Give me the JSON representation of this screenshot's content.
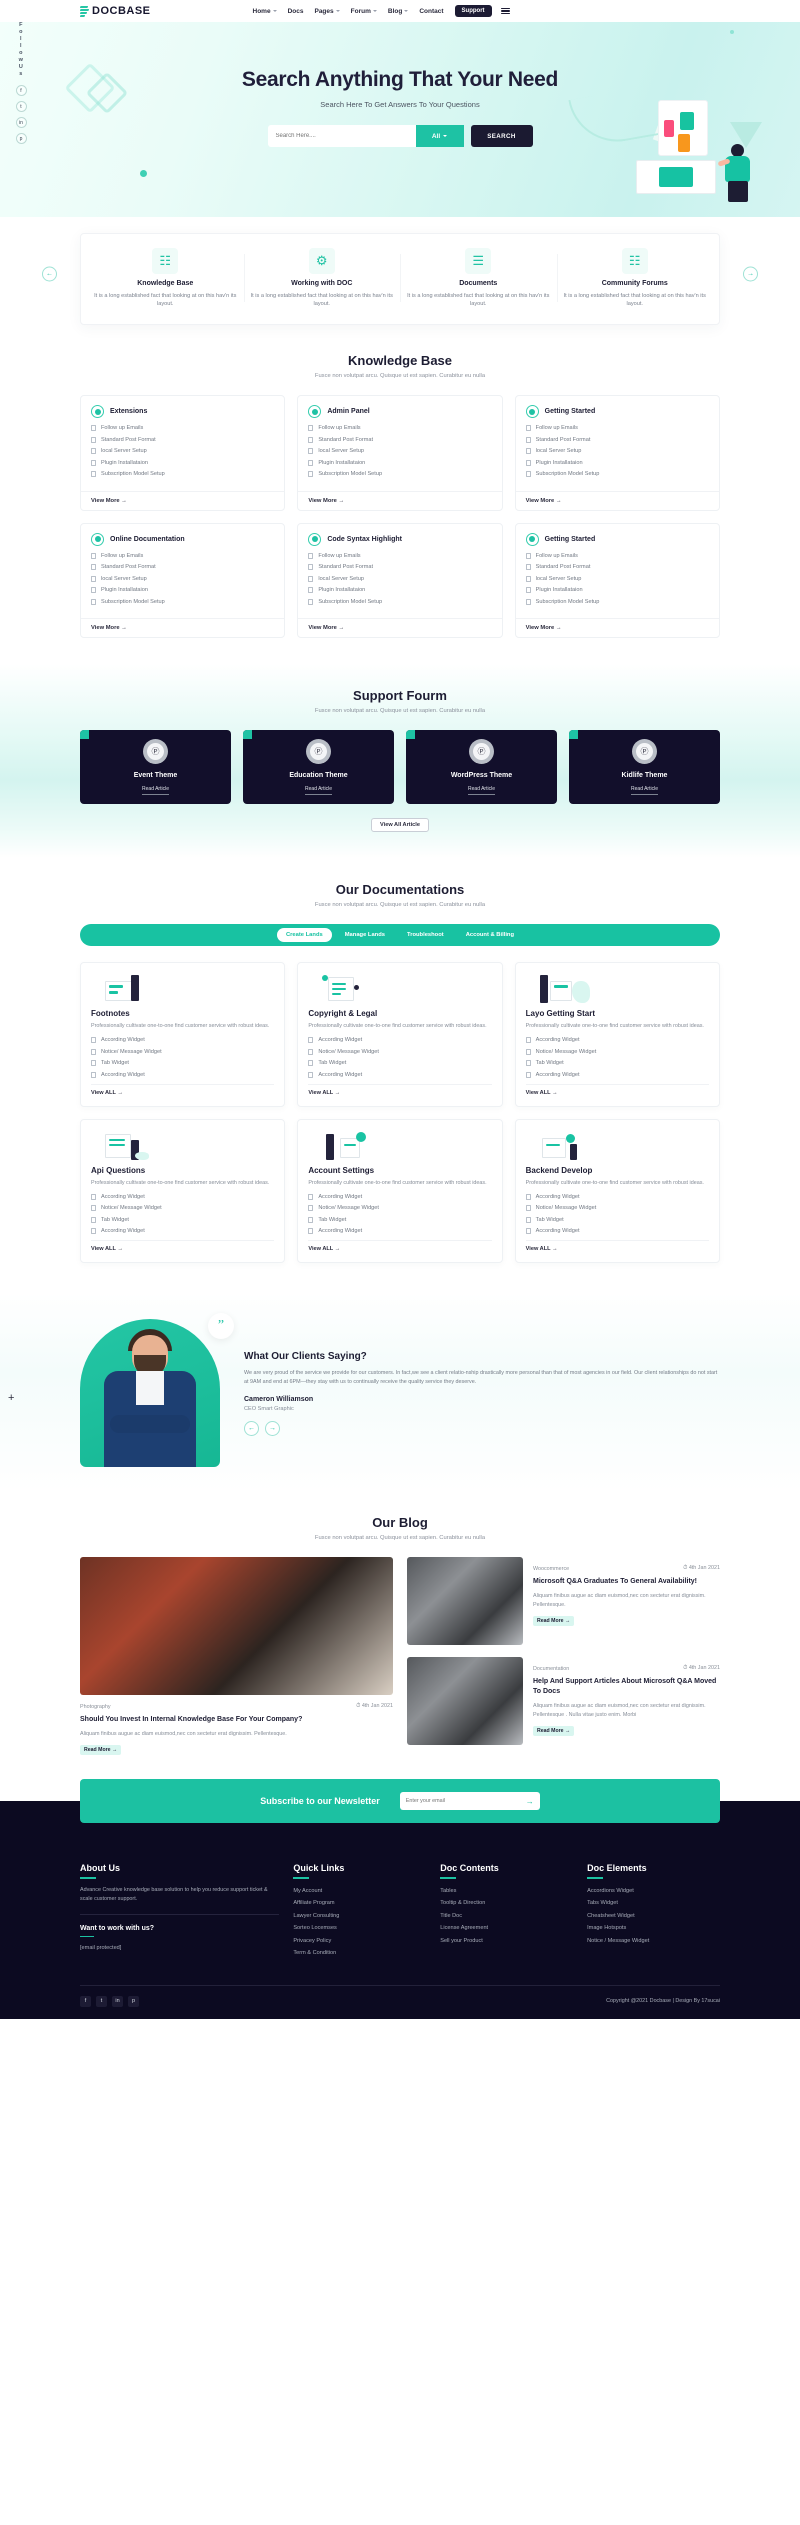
{
  "header": {
    "logo": "DOCBASE",
    "nav": [
      {
        "label": "Home",
        "caret": true
      },
      {
        "label": "Docs",
        "caret": false
      },
      {
        "label": "Pages",
        "caret": true
      },
      {
        "label": "Forum",
        "caret": true
      },
      {
        "label": "Blog",
        "caret": true
      },
      {
        "label": "Contact",
        "caret": false
      }
    ],
    "support_label": "Support",
    "menu_icon": "hamburger-icon"
  },
  "rail": {
    "text": "Follow Us",
    "icons": [
      "f",
      "t",
      "in",
      "p"
    ]
  },
  "hero": {
    "title": "Search Anything That Your Need",
    "subtitle": "Search Here To Get Answers To Your Questions",
    "search_placeholder": "Search Here....",
    "category": "All",
    "button": "SEARCH"
  },
  "features": {
    "prev_icon": "arrow-left-icon",
    "next_icon": "arrow-right-icon",
    "items": [
      {
        "icon": "book-icon",
        "glyph": "☷",
        "title": "Knowledge Base",
        "desc": "It is a long established fact that looking at on this hav'n its layout."
      },
      {
        "icon": "gear-doc-icon",
        "glyph": "⚙",
        "title": "Working with DOC",
        "desc": "It is a long established fact that looking at on this hav'n its layout."
      },
      {
        "icon": "document-check-icon",
        "glyph": "☰",
        "title": "Documents",
        "desc": "It is a long established fact that looking at on this hav'n its layout."
      },
      {
        "icon": "forum-icon",
        "glyph": "☷",
        "title": "Community Forums",
        "desc": "It is a long established fact that looking at on this hav'n its layout."
      }
    ]
  },
  "knowledge_base": {
    "title": "Knowledge Base",
    "subtitle": "Fusce non volutpat arcu. Quisque ut est sapien. Curabitur eu nulla",
    "view_more": "View More  →",
    "items": [
      "Follow up Emails",
      "Standard Post Format",
      "local Server Setup",
      "Plugin Installataion",
      "Subscription Model Setup"
    ],
    "cards": [
      {
        "title": "Extensions"
      },
      {
        "title": "Admin Panel"
      },
      {
        "title": "Getting Started"
      },
      {
        "title": "Online Documentation"
      },
      {
        "title": "Code Syntax Highlight"
      },
      {
        "title": "Getting Started"
      }
    ]
  },
  "forum": {
    "title": "Support Fourm",
    "subtitle": "Fusce non volutpat arcu. Quisque ut est sapien. Curabitur eu nulla",
    "read_article": "Read Article",
    "view_all": "View All Article",
    "cards": [
      {
        "title": "Event Theme",
        "avatar": "wordpress-icon"
      },
      {
        "title": "Education Theme",
        "avatar": "wordpress-icon"
      },
      {
        "title": "WordPress Theme",
        "avatar": "wordpress-icon"
      },
      {
        "title": "Kidlife Theme",
        "avatar": "wordpress-icon"
      }
    ]
  },
  "documentations": {
    "title": "Our Documentations",
    "subtitle": "Fusce non volutpat arcu. Quisque ut est sapien. Curabitur eu nulla",
    "tabs": [
      {
        "label": "Create Lands",
        "active": true
      },
      {
        "label": "Manage Lands",
        "active": false
      },
      {
        "label": "Troubleshoot",
        "active": false
      },
      {
        "label": "Account & Billing",
        "active": false
      }
    ],
    "view_all": "View ALL →",
    "desc": "Professionally cultivate one-to-one find customer service with robust ideas.",
    "widgets": [
      "According Widget",
      "Notice/ Message Widget",
      "Tab Widget",
      "According Widget"
    ],
    "cards": [
      {
        "title": "Footnotes"
      },
      {
        "title": "Copyright & Legal"
      },
      {
        "title": "Layo Getting Start"
      },
      {
        "title": "Api Questions"
      },
      {
        "title": "Account Settings"
      },
      {
        "title": "Backend Develop"
      }
    ]
  },
  "testimonial": {
    "heading": "What Our Clients Saying?",
    "body": "We are very proud of the service we provide for our customers. In fact,we see a client relatio-nship drastically more personal than that of most agencies in our field. Our client relationships do not start at 9AM and end at 6PM—they stay with us to continually receive the quality service they deserve.",
    "name": "Cameron Williamson",
    "role": "CEO Smart Graphic",
    "quote_glyph": "”",
    "prev_icon": "arrow-left-icon",
    "next_icon": "arrow-right-icon"
  },
  "blog": {
    "title": "Our Blog",
    "subtitle": "Fusce non volutpat arcu. Quisque ut est sapien. Curabitur eu nulla",
    "read_more": "Read More →",
    "featured": {
      "category": "Photography",
      "date": "4th Jan 2021",
      "title": "Should You Invest In Internal Knowledge Base For Your Company?",
      "excerpt": "Aliquam finibus augue ac diam euismod,nec con sectetur erat dignissim. Pellentesque."
    },
    "posts": [
      {
        "category": "Woocommerce",
        "date": "4th Jan 2021",
        "title": "Microsoft Q&A Graduates To General Availability!",
        "excerpt": "Aliquam finibus augue ac diam euismod,nec con sectetur erat dignissim. Pellentesque."
      },
      {
        "category": "Documentation",
        "date": "4th Jan 2021",
        "title": "Help And Support Articles About Microsoft Q&A Moved To Docs",
        "excerpt": "Aliquam finibus augue ac diam euismod,nec con sectetur erat dignissim. Pellentesque . Nulla vitae justo enim. Morbi"
      }
    ]
  },
  "newsletter": {
    "title": "Subscribe to our Newsletter",
    "placeholder": "Enter your email",
    "submit_icon": "arrow-right-icon"
  },
  "footer": {
    "about": {
      "heading": "About Us",
      "text": "Advance Creative knowledge base solution to help you reduce support ticket & scale customer support.",
      "work_heading": "Want to work with us?",
      "email": "[email protected]"
    },
    "columns": [
      {
        "heading": "Quick Links",
        "links": [
          "My Account",
          "Affiliate Program",
          "Lawyer Consulting",
          "Sorteo Locemses",
          "Privacey Policy",
          "Term & Condition"
        ]
      },
      {
        "heading": "Doc Contents",
        "links": [
          "Tables",
          "Tooltip & Direction",
          "Title Doc",
          "License Agreement",
          "Sell your Product"
        ]
      },
      {
        "heading": "Doc Elements",
        "links": [
          "Accordions Widget",
          "Tabs Widget",
          "Cheatsheet Widget",
          "Image Hotspots",
          "Notice / Message Widget"
        ]
      }
    ],
    "social": [
      "f",
      "t",
      "in",
      "p"
    ],
    "copyright": "Copyright @2021 Docbase | Design By 17sucai"
  }
}
